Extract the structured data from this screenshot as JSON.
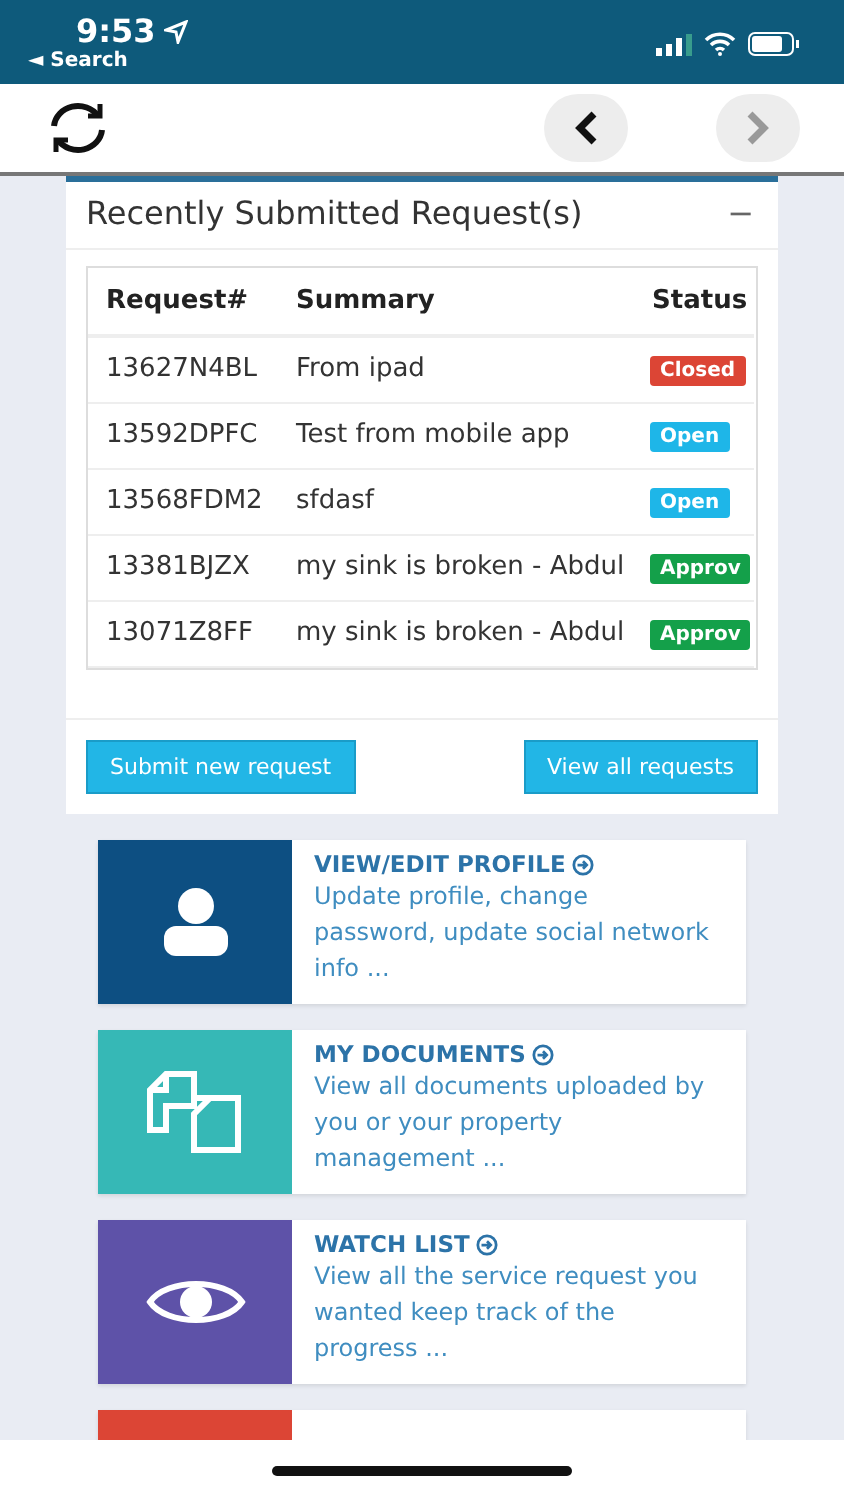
{
  "status_bar": {
    "time": "9:53",
    "back_label": "◄ Search"
  },
  "toolbar": {
    "back_enabled": true,
    "forward_enabled": false
  },
  "requests_panel": {
    "title": "Recently Submitted Request(s)",
    "collapse_symbol": "−",
    "columns": [
      "Request#",
      "Summary",
      "Status"
    ],
    "rows": [
      {
        "id": "13627N4BL",
        "summary": "From ipad",
        "status": "Closed",
        "color": "#dc4535"
      },
      {
        "id": "13592DPFC",
        "summary": "Test from mobile app",
        "status": "Open",
        "color": "#1eb6e8"
      },
      {
        "id": "13568FDM2",
        "summary": "sfdasf",
        "status": "Open",
        "color": "#1eb6e8"
      },
      {
        "id": "13381BJZX",
        "summary": "my sink is broken - Abdul",
        "status": "Approv",
        "color": "#14a04a"
      },
      {
        "id": "13071Z8FF",
        "summary": "my sink is broken - Abdul",
        "status": "Approv",
        "color": "#14a04a"
      }
    ],
    "buttons": [
      "Submit new request",
      "View all requests"
    ]
  },
  "tiles": [
    {
      "kind": "profile",
      "color": "#0d4f82",
      "title": "VIEW/EDIT PROFILE",
      "text": "Update profile, change password, update social network info ..."
    },
    {
      "kind": "documents",
      "color": "#36b8b6",
      "title": "MY DOCUMENTS",
      "text": "View all documents uploaded by you or your property management ..."
    },
    {
      "kind": "watch",
      "color": "#5e52a8",
      "title": "WATCH LIST",
      "text": "View all the service request you wanted keep track of the progress ..."
    },
    {
      "kind": "partial",
      "color": "#dc4535"
    }
  ]
}
